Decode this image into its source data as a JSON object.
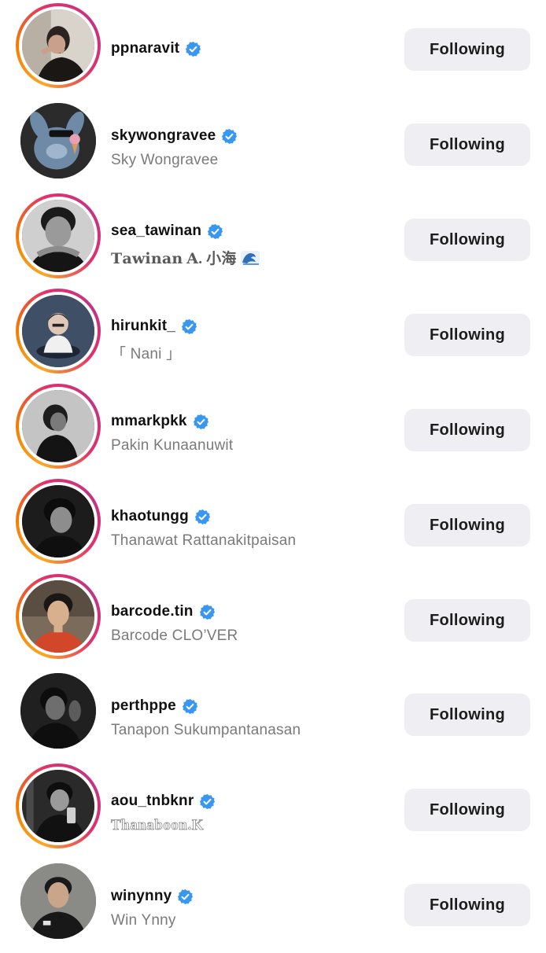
{
  "accent": {
    "verified_blue": "#3897f0",
    "button_bg": "#efeff3",
    "story_ring": [
      "#f9a825",
      "#e1306c",
      "#c13584"
    ]
  },
  "users": [
    {
      "username": "ppnaravit",
      "full_name": "",
      "button": "Following",
      "has_story_ring": true,
      "verified": true
    },
    {
      "username": "skywongravee",
      "full_name": "Sky Wongravee",
      "button": "Following",
      "has_story_ring": false,
      "verified": true
    },
    {
      "username": "sea_tawinan",
      "full_name": "𝐓𝐚𝐰𝐢𝐧𝐚𝐧 𝐀. 小海",
      "full_name_emoji": "wave-emoji",
      "button": "Following",
      "has_story_ring": true,
      "verified": true
    },
    {
      "username": "hirunkit_",
      "full_name": "「 Nani 」",
      "button": "Following",
      "has_story_ring": true,
      "verified": true
    },
    {
      "username": "mmarkpkk",
      "full_name": "Pakin Kunaanuwit",
      "button": "Following",
      "has_story_ring": true,
      "verified": true
    },
    {
      "username": "khaotungg",
      "full_name": "Thanawat Rattanakitpaisan",
      "button": "Following",
      "has_story_ring": true,
      "verified": true
    },
    {
      "username": "barcode.tin",
      "full_name": "Barcode CLO’VER",
      "button": "Following",
      "has_story_ring": true,
      "verified": true
    },
    {
      "username": "perthppe",
      "full_name": "Tanapon Sukumpantanasan",
      "button": "Following",
      "has_story_ring": false,
      "verified": true
    },
    {
      "username": "aou_tnbknr",
      "full_name": "Thanaboon.K",
      "button": "Following",
      "has_story_ring": true,
      "verified": true
    },
    {
      "username": "winynny",
      "full_name": "Win Ynny",
      "button": "Following",
      "has_story_ring": false,
      "verified": true
    }
  ]
}
